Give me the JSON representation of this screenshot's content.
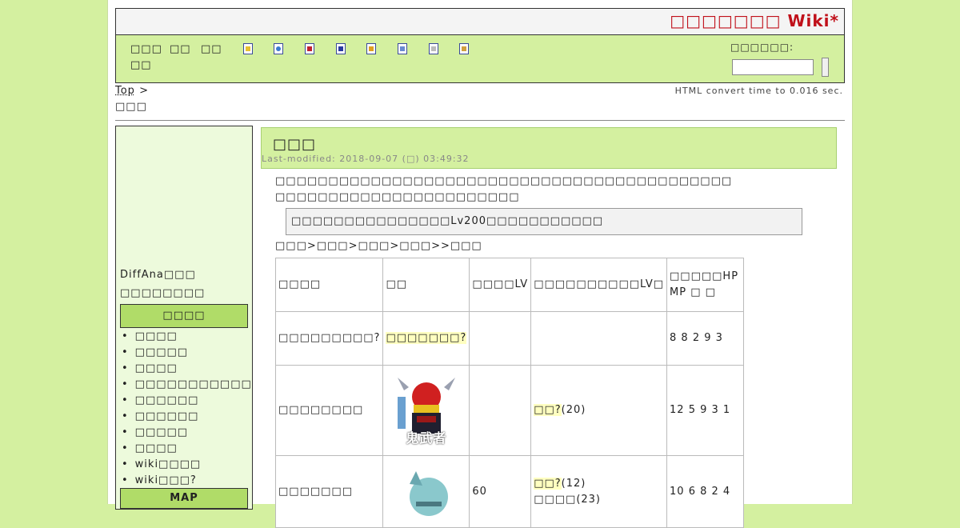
{
  "site": {
    "title": "□□□□□□□ Wiki*"
  },
  "toolbar": {
    "nav": [
      "□□□",
      "□□",
      "□□",
      "□□"
    ],
    "icons": [
      "new-page-icon",
      "edit-icon",
      "diff-icon",
      "backup-icon",
      "freeze-icon",
      "copy-icon",
      "list-icon",
      "help-icon"
    ],
    "search_label": "□□□□□□:",
    "search_value": ""
  },
  "breadcrumb": {
    "top": "Top",
    "sep": ">",
    "current": "□□□"
  },
  "convert_time": "HTML convert time to 0.016 sec.",
  "sidebar": {
    "diffana": "DiffAna□□□",
    "sub": "□□□□□□□□",
    "menu_header": "□□□□",
    "items": [
      "□□□□",
      "□□□□□",
      "□□□□",
      "□□□□□□□□□□□",
      "□□□□□□",
      "□□□□□□",
      "□□□□□",
      "□□□□",
      "wiki□□□□",
      "wiki□□□?"
    ],
    "map_header": "MAP"
  },
  "main": {
    "title": "□□□",
    "modified": "Last-modified: 2018-09-07 (□) 03:49:32",
    "desc1": "□□□□□□□□□□□□□□□□□□□□□□□□□□□□□□□□□□□□□□□□□□□",
    "desc2": "□□□□□□□□□□□□□□□□□□□□□□□",
    "notice": "□□□□□□□□□□□□□□□Lv200□□□□□□□□□□□",
    "path": "□□□>□□□>□□□>□□□>>□□□"
  },
  "table": {
    "headers": [
      "□□□□",
      "□□",
      "□□□□LV",
      "□□□□□□□□□□LV□",
      "□□□□□HP MP □ □"
    ],
    "rows": [
      {
        "name": "□□□□□□□□□?",
        "image": "□□□□□□□?",
        "lv": "",
        "drop": "",
        "stats": "8 8 2 9 3"
      },
      {
        "name": "□□□□□□□□",
        "image": "鬼武者",
        "lv": "",
        "drop_link": "□□?",
        "drop_rest": "(20)",
        "stats": "12 5 9 3 1"
      },
      {
        "name": "□□□□□□□",
        "image": "",
        "lv": "60",
        "drop_link": "□□?",
        "drop_rest": "(12)",
        "drop2": "□□□□(23)",
        "stats": "10 6 8 2 4"
      }
    ]
  }
}
